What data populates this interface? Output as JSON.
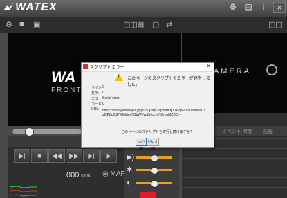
{
  "app": {
    "logo_text": "WATEX"
  },
  "window_icons": {
    "settings": "⚙",
    "list": "▤",
    "info": "i",
    "close": "×"
  },
  "panels": {
    "front_brand": "WA",
    "front_label": "FRONT C",
    "rear_label": "R CAMERA"
  },
  "controls": {
    "speed_value": "000",
    "speed_unit": "km/h",
    "map_label": "MAP"
  },
  "list": {
    "col_event": "イベント",
    "col_time": "時間",
    "col_mode": "記録"
  },
  "dialog": {
    "title": "スクリプト エラー",
    "message": "このページのスクリプトでエラーが発生しました。",
    "fields": [
      {
        "key": "ライン:",
        "value": "0"
      },
      {
        "key": "文字:",
        "value": "0"
      },
      {
        "key": "エラー:",
        "value": "Script error."
      },
      {
        "key": "コード:",
        "value": "0"
      },
      {
        "key": "URL:",
        "value": ""
      }
    ],
    "url": "https://map.yahooapis.jp/js/V1/jsapi?appid=dj00aiZpPVJvTHdOUTIzZjFZcZdPWlNdenN1bWVyc2Vjc mVtGmgMZDQ-",
    "question": "このページのスクリプトを実行し続けますか?",
    "yes_label": "はい(Y)",
    "no_label": "いいえ(N)"
  }
}
